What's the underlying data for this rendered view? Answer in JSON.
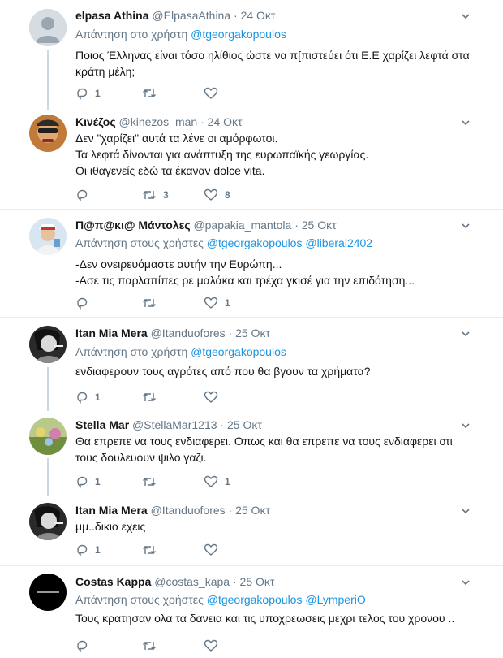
{
  "tweets": [
    {
      "name": "elpasa Athina",
      "handle": "@ElpasaAthina",
      "time": "24 Οκτ",
      "reply_prefix": "Απάντηση στο χρήστη",
      "mentions": [
        "@tgeorgakopoulos"
      ],
      "lines": [
        "Ποιος Έλληνας είναι τόσο ηλίθιος ώστε να π[πιστεύει ότι Ε.Ε χαρίζει λεφτά στα",
        "κράτη μέλη;"
      ],
      "replies": "1",
      "retweets": "",
      "likes": "",
      "avatar": "default-avatar"
    },
    {
      "name": "Κινέζος",
      "handle": "@kinezos_man",
      "time": "24 Οκτ",
      "reply_prefix": "",
      "mentions": [],
      "lines": [
        "Δεν \"χαρίζει\"  αυτά τα λένε οι αμόρφωτοι.",
        "Τα λεφτά δίνονται για ανάπτυξη της ευρωπαϊκής γεωργίας.",
        "Οι ιθαγενείς εδώ τα έκαναν dolce vita."
      ],
      "replies": "",
      "retweets": "3",
      "likes": "8",
      "avatar": "photo-avatar"
    },
    {
      "name": "Π@π@κι@ Μάντολες",
      "handle": "@papakia_mantola",
      "time": "25 Οκτ",
      "reply_prefix": "Απάντηση στους χρήστες",
      "mentions": [
        "@tgeorgakopoulos",
        "@liberal2402"
      ],
      "lines": [
        "-Δεν ονειρευόμαστε αυτήν την Ευρώπη...",
        "-Ασε τις παρλαπίπες ρε μαλάκα και τρέχα γκισέ για την επιδότηση..."
      ],
      "replies": "",
      "retweets": "",
      "likes": "1",
      "avatar": "photo-avatar"
    },
    {
      "name": "Itan Mia Mera",
      "handle": "@Itanduofores",
      "time": "25 Οκτ",
      "reply_prefix": "Απάντηση στο χρήστη",
      "mentions": [
        "@tgeorgakopoulos"
      ],
      "lines": [
        "ενδιαφερουν τους αγρότες από που θα βγουν τα χρήματα?"
      ],
      "replies": "1",
      "retweets": "",
      "likes": "",
      "avatar": "photo-avatar"
    },
    {
      "name": "Stella Mar",
      "handle": "@StellaMar1213",
      "time": "25 Οκτ",
      "reply_prefix": "",
      "mentions": [],
      "lines": [
        "Θα επρεπε να τους ενδιαφερει. Οπως και θα επρεπε να τους ενδιαφερει οτι",
        "τους δουλευουν ψιλο γαζι."
      ],
      "replies": "1",
      "retweets": "",
      "likes": "1",
      "avatar": "photo-avatar"
    },
    {
      "name": "Itan Mia Mera",
      "handle": "@Itanduofores",
      "time": "25 Οκτ",
      "reply_prefix": "",
      "mentions": [],
      "lines": [
        "μμ..δικιο εχεις"
      ],
      "replies": "1",
      "retweets": "",
      "likes": "",
      "avatar": "photo-avatar"
    },
    {
      "name": "Costas Kappa",
      "handle": "@costas_kapa",
      "time": "25 Οκτ",
      "reply_prefix": "Απάντηση στους χρήστες",
      "mentions": [
        "@tgeorgakopoulos",
        "@LymperiO"
      ],
      "lines": [
        "Τους κρατησαν ολα τα δανεια και τις υποχρεωσεις  μεχρι τελος του χρονου  .."
      ],
      "replies": "",
      "retweets": "",
      "likes": "",
      "avatar": "photo-avatar"
    }
  ],
  "colors": {
    "accent": "#1b95e0",
    "muted": "#657786",
    "separator": "#e6ecf0",
    "thread": "#ccd6dd"
  }
}
